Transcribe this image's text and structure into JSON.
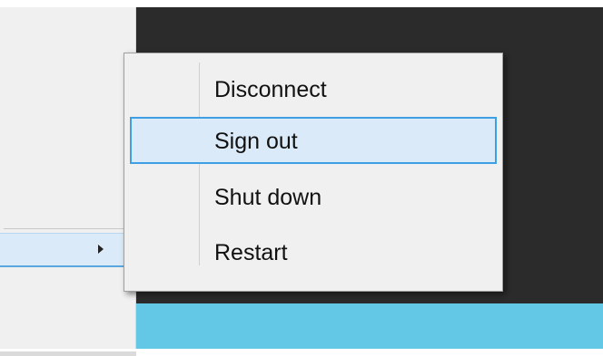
{
  "power_menu": {
    "items": [
      {
        "label": "Disconnect",
        "highlighted": false
      },
      {
        "label": "Sign out",
        "highlighted": true
      },
      {
        "label": "Shut down",
        "highlighted": false
      },
      {
        "label": "Restart",
        "highlighted": false
      }
    ]
  },
  "colors": {
    "desktop": "#2b2b2b",
    "taskbar_accent": "#63c7e6",
    "menu_background": "#f0f0f0",
    "highlight_fill": "#dbeaf8",
    "highlight_border": "#3ea0e2"
  },
  "icons": {
    "power_submenu_arrow": "chevron-right-icon"
  }
}
